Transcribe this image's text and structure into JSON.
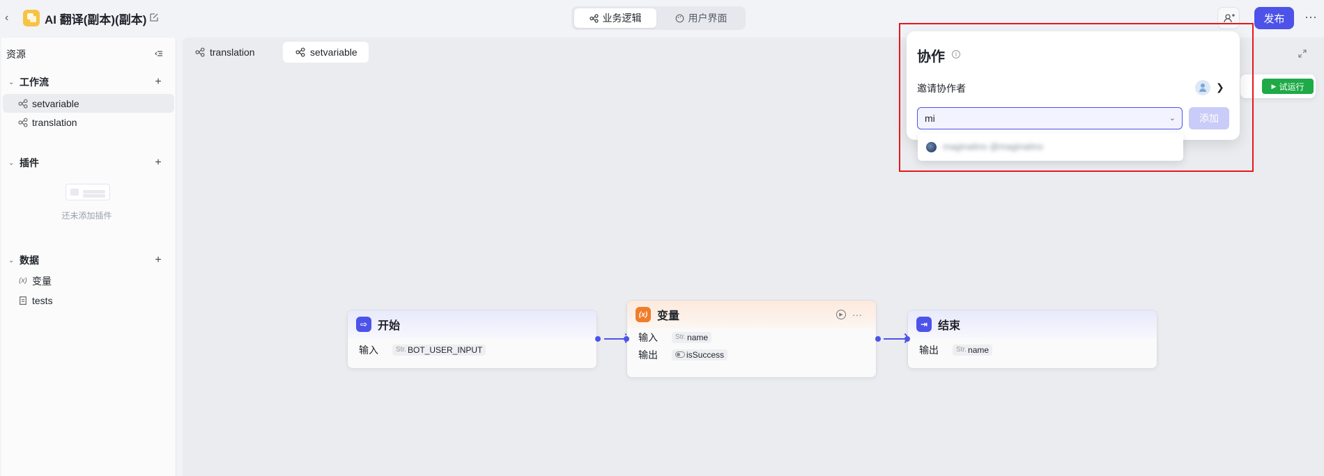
{
  "app": {
    "title": "AI 翻译(副本)(副本)"
  },
  "header": {
    "segments": [
      {
        "label": "业务逻辑"
      },
      {
        "label": "用户界面"
      }
    ],
    "publish_label": "发布",
    "more_label": "···"
  },
  "sidebar": {
    "title": "资源",
    "sections": {
      "workflow": {
        "label": "工作流",
        "items": [
          "setvariable",
          "translation"
        ]
      },
      "plugin": {
        "label": "插件",
        "empty_text": "还未添加插件"
      },
      "data": {
        "label": "数据",
        "items": [
          "变量",
          "tests"
        ]
      }
    }
  },
  "canvas": {
    "tabs": [
      {
        "label": "translation"
      },
      {
        "label": "setvariable"
      }
    ],
    "nodes": {
      "start": {
        "title": "开始",
        "row_label": "输入",
        "param_type": "Str.",
        "param": "BOT_USER_INPUT"
      },
      "variable": {
        "title": "变量",
        "input_label": "输入",
        "input_type": "Str.",
        "input_param": "name",
        "output_label": "输出",
        "output_param": "isSuccess"
      },
      "end": {
        "title": "结束",
        "row_label": "输出",
        "param_type": "Str.",
        "param": "name"
      }
    },
    "trial_run_label": "试运行"
  },
  "collab_popover": {
    "title": "协作",
    "invite_label": "邀请协作者",
    "input_value": "mi",
    "add_label": "添加",
    "suggestion_name": "maginatino @maginatino"
  },
  "colors": {
    "accent": "#4d53e8",
    "success": "#1eaa46",
    "highlight": "#e5171c"
  }
}
